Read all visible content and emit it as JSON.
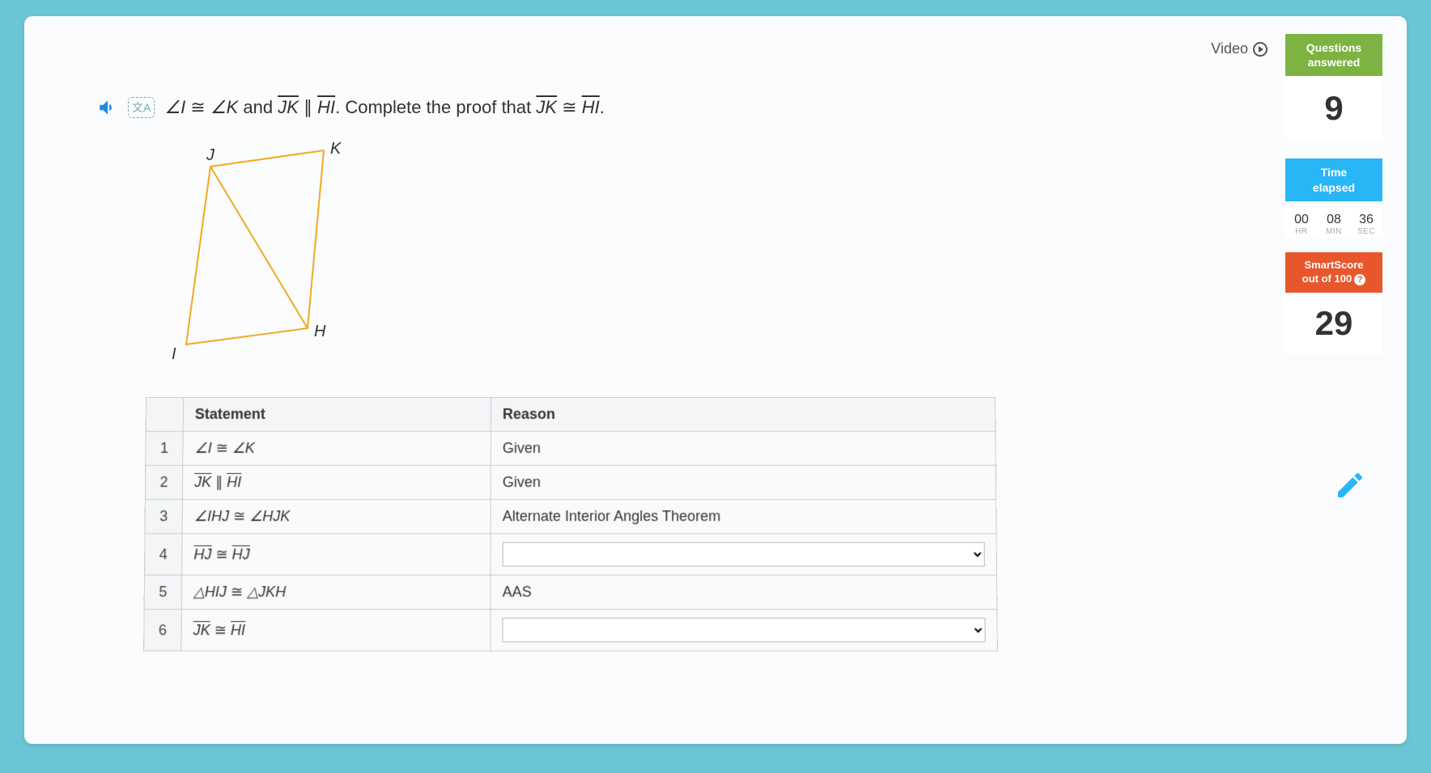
{
  "toolbar": {
    "video_label": "Video"
  },
  "sidebar": {
    "questions_label": "Questions\nanswered",
    "questions_value": "9",
    "time_label": "Time\nelapsed",
    "time": {
      "hr": "00",
      "min": "08",
      "sec": "36",
      "hr_lbl": "HR",
      "min_lbl": "MIN",
      "sec_lbl": "SEC"
    },
    "smart_label": "SmartScore\nout of 100",
    "smart_value": "29"
  },
  "question": {
    "prefix": "∠I ≅ ∠K and ",
    "mid1": "JK",
    "parallel": " ∥ ",
    "mid2": "HI",
    "suffix": ". Complete the proof that ",
    "mid3": "JK",
    "cong": " ≅ ",
    "mid4": "HI",
    "end": "."
  },
  "diagram": {
    "labels": {
      "J": "J",
      "K": "K",
      "I": "I",
      "H": "H"
    }
  },
  "table": {
    "head_statement": "Statement",
    "head_reason": "Reason",
    "rows": [
      {
        "n": "1",
        "stmt_html": "∠I ≅ ∠K",
        "reason": "Given",
        "reason_editable": false
      },
      {
        "n": "2",
        "stmt_html": "JK ∥ HI",
        "reason": "Given",
        "reason_editable": false
      },
      {
        "n": "3",
        "stmt_html": "∠IHJ ≅ ∠HJK",
        "reason": "Alternate Interior Angles Theorem",
        "reason_editable": false
      },
      {
        "n": "4",
        "stmt_html": "HJ ≅ HJ",
        "reason": "",
        "reason_editable": true
      },
      {
        "n": "5",
        "stmt_html": "△HIJ ≅ △JKH",
        "reason": "AAS",
        "reason_editable": false
      },
      {
        "n": "6",
        "stmt_html": "JK ≅ HI",
        "reason": "",
        "reason_editable": true
      }
    ]
  }
}
